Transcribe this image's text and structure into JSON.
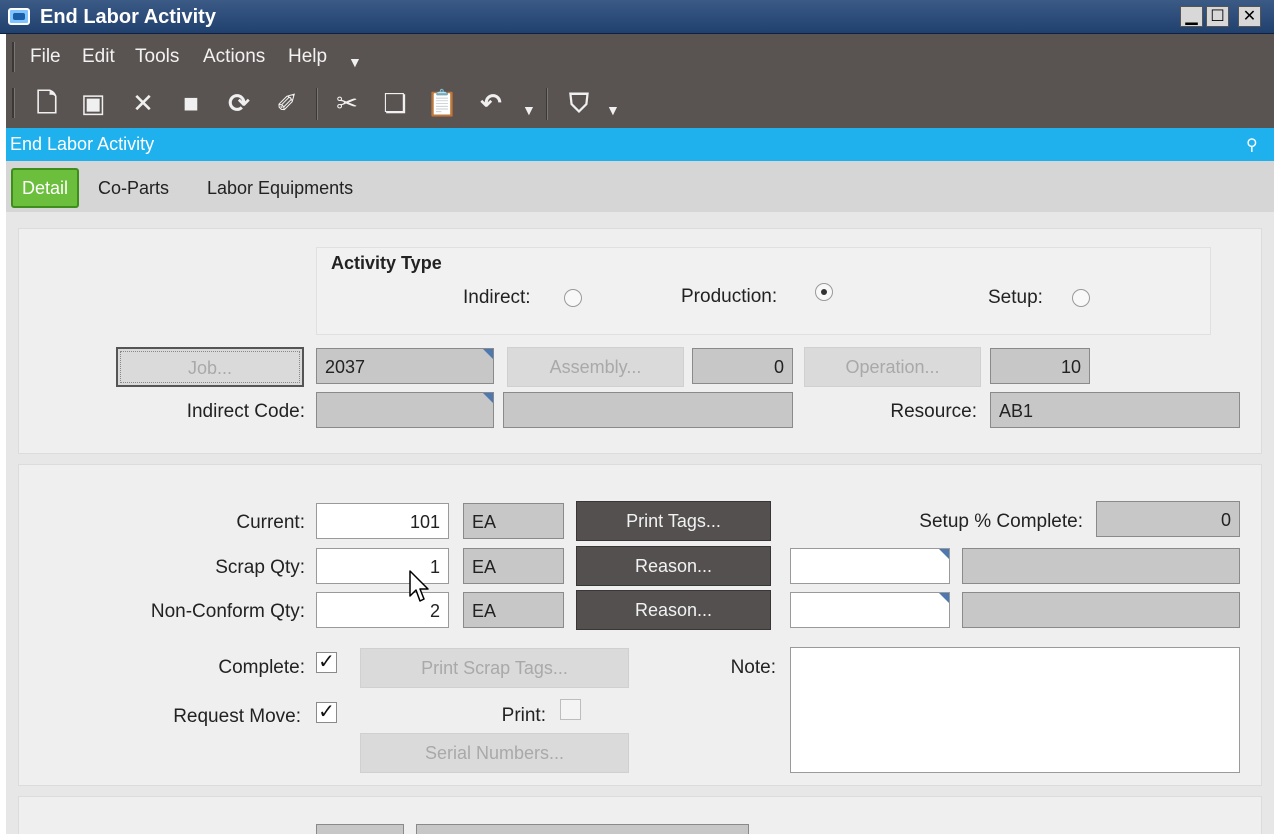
{
  "window": {
    "title": "End Labor Activity",
    "controls": {
      "minimize": "▁",
      "maximize": "☐",
      "close": "✕"
    }
  },
  "menu": [
    "File",
    "Edit",
    "Tools",
    "Actions",
    "Help"
  ],
  "menu_dropdown": "▼",
  "toolbar": {
    "icons": [
      "new-icon",
      "save-icon",
      "delete-icon",
      "clear-icon",
      "refresh-icon",
      "attach-icon",
      "cut-icon",
      "copy-icon",
      "paste-icon",
      "undo-icon",
      "search-icon"
    ],
    "glyphs": {
      "new": "🗋",
      "save": "▣",
      "delete": "✕",
      "clear": "■",
      "refresh": "⟳",
      "attach": "✐",
      "cut": "✂",
      "copy": "❏",
      "paste": "📋",
      "undo": "↶",
      "search": "⛉"
    }
  },
  "form_title": "End Labor Activity",
  "pin_glyph": "⚲",
  "tabs": [
    "Detail",
    "Co-Parts",
    "Labor Equipments"
  ],
  "activity_type": {
    "heading": "Activity Type",
    "options": [
      {
        "label": "Indirect:",
        "selected": false
      },
      {
        "label": "Production:",
        "selected": true
      },
      {
        "label": "Setup:",
        "selected": false
      }
    ]
  },
  "job": {
    "button": "Job...",
    "value": "2037"
  },
  "assembly": {
    "button": "Assembly...",
    "value": "0"
  },
  "operation": {
    "button": "Operation...",
    "value": "10"
  },
  "indirect_code": {
    "label": "Indirect Code:",
    "value": "",
    "description": ""
  },
  "resource": {
    "label": "Resource:",
    "value": "AB1"
  },
  "current": {
    "label": "Current:",
    "value": "101",
    "uom": "EA",
    "button": "Print Tags..."
  },
  "setup_complete": {
    "label": "Setup % Complete:",
    "value": "0"
  },
  "scrap": {
    "label": "Scrap Qty:",
    "value": "1",
    "uom": "EA",
    "button": "Reason...",
    "reason_code": "",
    "reason_desc": ""
  },
  "nonconform": {
    "label": "Non-Conform Qty:",
    "value": "2",
    "uom": "EA",
    "button": "Reason...",
    "reason_code": "",
    "reason_desc": ""
  },
  "complete": {
    "label": "Complete:",
    "checked": true,
    "mark": "✓"
  },
  "print_scrap_tags": "Print Scrap Tags...",
  "note": {
    "label": "Note:",
    "value": ""
  },
  "request_move": {
    "label": "Request Move:",
    "checked": true,
    "mark": "✓"
  },
  "print": {
    "label": "Print:",
    "checked": false
  },
  "serial_numbers": "Serial Numbers..."
}
